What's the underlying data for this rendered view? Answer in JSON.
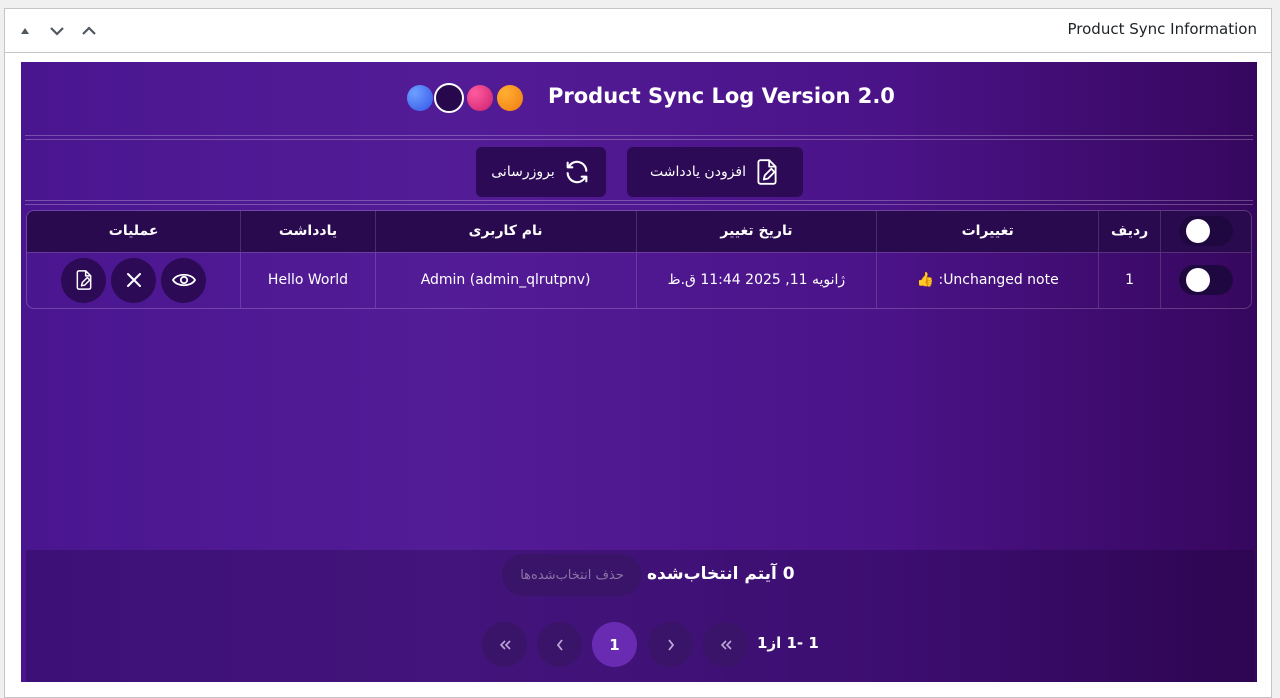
{
  "postbox": {
    "title": "Product Sync Information"
  },
  "header": {
    "title": "Product Sync Log Version 2.0"
  },
  "toolbar": {
    "add_note_label": "افزودن یادداشت",
    "refresh_label": "بروزرسانی"
  },
  "table": {
    "columns": [
      "ردیف",
      "تغییرات",
      "تاریخ تغییر",
      "نام کاربری",
      "یادداشت",
      "عملیات"
    ],
    "rows": [
      {
        "index": "1",
        "changes": "Unchanged note: 👍",
        "date": "ژانویه 11, 2025 11:44 ق.ظ",
        "username": "Admin (admin_qlrutpnv)",
        "note": "Hello World"
      }
    ]
  },
  "footer": {
    "selected_count": "0 آیتم انتخاب‌شده",
    "delete_selected_label": "حذف انتخاب‌شده‌ها",
    "current_page": "1",
    "page_range": "1 -1 از1"
  }
}
